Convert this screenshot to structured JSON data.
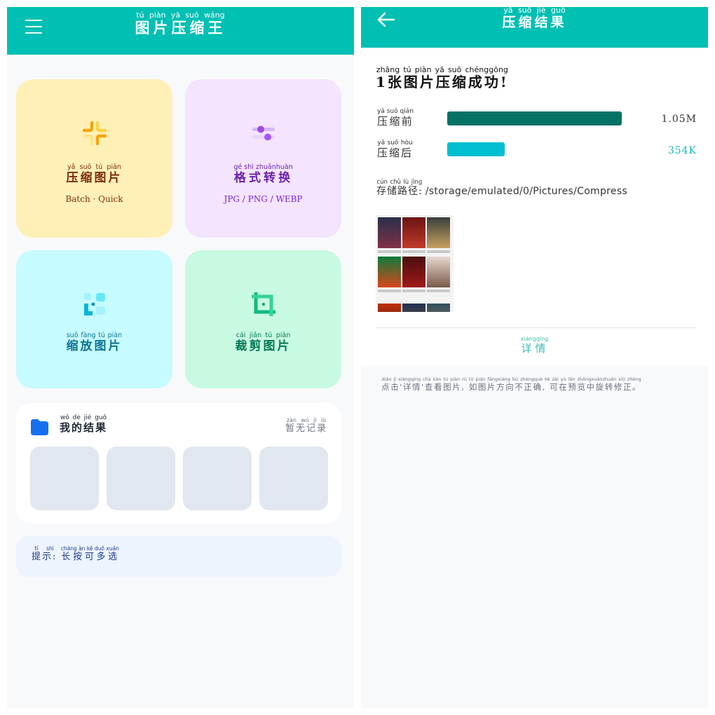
{
  "left": {
    "header": {
      "title": "图片压缩王",
      "title_pinyin": "tú piàn yā suō wáng",
      "menu_icon": "menu-icon"
    },
    "cards": {
      "compress": {
        "label": "压缩图片",
        "pinyin": "yā suō tú piàn",
        "sub": "Batch · Quick",
        "icon": "compress-icon",
        "bg": "#fff0b8",
        "accent": "#f5a50b"
      },
      "format": {
        "label": "格式转换",
        "pinyin": "gé shì zhuǎnhuàn",
        "sub": "JPG / PNG / WEBP",
        "icon": "convert-icon",
        "bg": "#f4e4fd",
        "accent": "#9d4edd"
      },
      "scale": {
        "label": "缩放图片",
        "pinyin": "suō fàng tú piàn",
        "icon": "resize-icon",
        "bg": "#c6fbff",
        "accent": "#06b6d4"
      },
      "crop": {
        "label": "裁剪图片",
        "pinyin": "cái jiǎn tú piàn",
        "icon": "crop-icon",
        "bg": "#c8fae1",
        "accent": "#10b981"
      }
    },
    "results": {
      "title": "我的结果",
      "title_pinyin": "wǒ de jié guǒ",
      "empty": "暂无记录",
      "empty_pinyin": "zàn wú jì lù",
      "icon": "folder-icon"
    },
    "tip": {
      "label": "提示:",
      "label_pinyin": "tí shì",
      "text": "长按可多选",
      "text_pinyin": "cháng àn kě duō xuǎn"
    }
  },
  "right": {
    "header": {
      "title": "压缩结果",
      "title_pinyin": "yā suō jié guǒ",
      "back_icon": "back-arrow-icon"
    },
    "success": {
      "text": "1张图片压缩成功!",
      "pinyin": "zhāng tú piàn yā suō chénggōng"
    },
    "before": {
      "label": "压缩前",
      "pinyin": "yā suō qián",
      "value": "1.05M",
      "ratio": 1.0,
      "color": "#047265"
    },
    "after": {
      "label": "压缩后",
      "pinyin": "yā suō hòu",
      "value": "354K",
      "ratio": 0.33,
      "color": "#00bfd0"
    },
    "path": {
      "label": "存储路径:",
      "label_pinyin": "cún chǔ lù jìng",
      "value": "/storage/emulated/0/Pictures/Compress"
    },
    "detail": {
      "label": "详情",
      "pinyin": "xiángqíng"
    },
    "note": {
      "text": "点击'详情'查看图片, 如图片方向不正确, 可在预览中旋转修正。",
      "pinyin": "diǎn jī xiángqíng chá kàn tú piàn rú tú piàn fāngxiàng bù zhèngquè kě zài yù lǎn zhōngxuánzhuǎn xiū zhèng"
    }
  }
}
